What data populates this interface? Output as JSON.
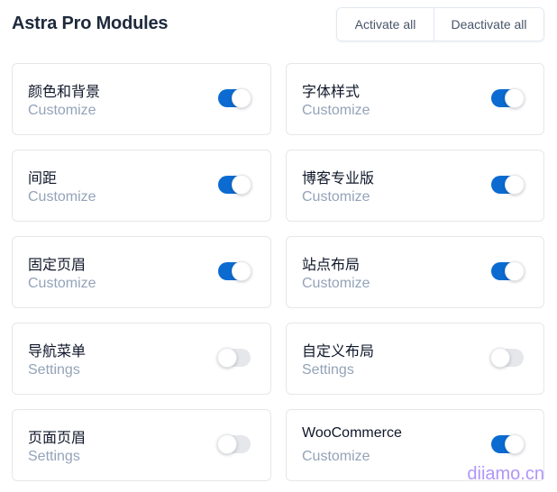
{
  "header": {
    "title": "Astra Pro Modules",
    "activate_all_label": "Activate all",
    "deactivate_all_label": "Deactivate all"
  },
  "colors": {
    "toggle_on": "#0b6bd1",
    "toggle_off": "#e5e7eb",
    "title": "#1e293b",
    "link": "#94a3b8"
  },
  "modules": [
    {
      "name": "颜色和背景",
      "link": "Customize",
      "enabled": true
    },
    {
      "name": "字体样式",
      "link": "Customize",
      "enabled": true
    },
    {
      "name": "间距",
      "link": "Customize",
      "enabled": true
    },
    {
      "name": "博客专业版",
      "link": "Customize",
      "enabled": true
    },
    {
      "name": "固定页眉",
      "link": "Customize",
      "enabled": true
    },
    {
      "name": "站点布局",
      "link": "Customize",
      "enabled": true
    },
    {
      "name": "导航菜单",
      "link": "Settings",
      "enabled": false
    },
    {
      "name": "自定义布局",
      "link": "Settings",
      "enabled": false
    },
    {
      "name": "页面页眉",
      "link": "Settings",
      "enabled": false
    },
    {
      "name": "WooCommerce",
      "link": "Customize",
      "enabled": true
    }
  ],
  "watermark": "diiamo.cn"
}
